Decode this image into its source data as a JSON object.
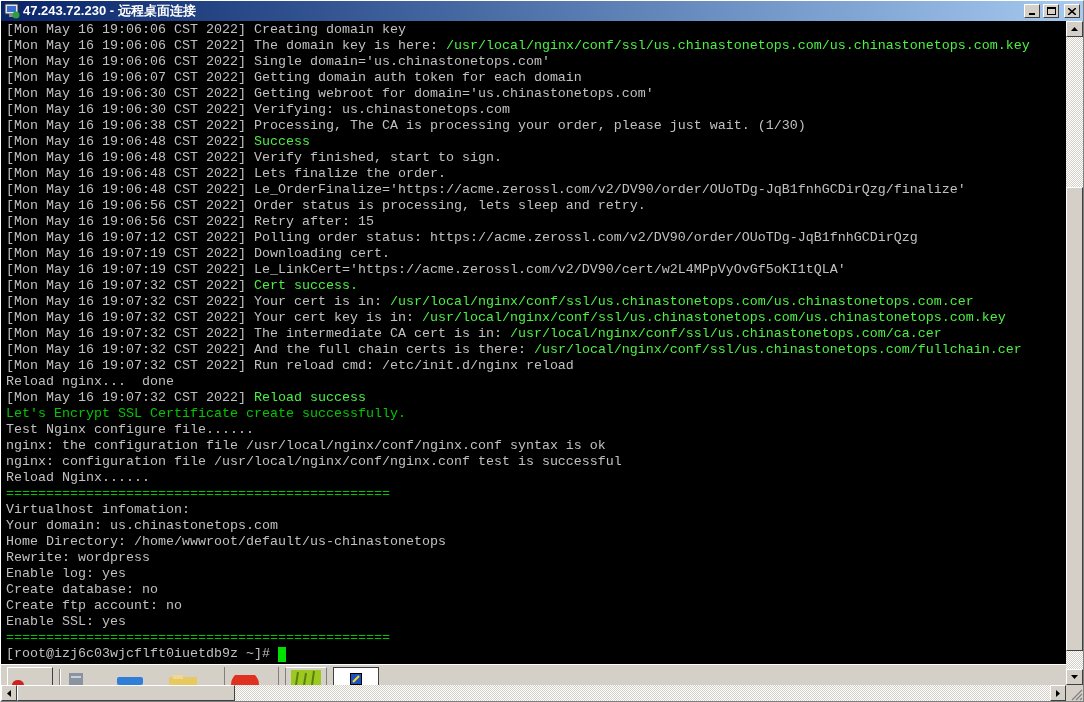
{
  "window": {
    "title": "47.243.72.230 - 远程桌面连接"
  },
  "terminal": {
    "lines": [
      {
        "parts": [
          {
            "text": "[Mon May 16 19:06:06 CST 2022] Creating domain key",
            "kind": "plain"
          }
        ]
      },
      {
        "parts": [
          {
            "text": "[Mon May 16 19:06:06 CST 2022] The domain key is here:",
            "kind": "plain"
          },
          {
            "text": "/usr/local/nginx/conf/ssl/us.chinastonetops.com/us.chinastonetops.com.key",
            "kind": "bright"
          }
        ]
      },
      {
        "parts": [
          {
            "text": "[Mon May 16 19:06:06 CST 2022] Single domain='us.chinastonetops.com'",
            "kind": "plain"
          }
        ]
      },
      {
        "parts": [
          {
            "text": "[Mon May 16 19:06:07 CST 2022] Getting domain auth token for each domain",
            "kind": "plain"
          }
        ]
      },
      {
        "parts": [
          {
            "text": "[Mon May 16 19:06:30 CST 2022] Getting webroot for domain='us.chinastonetops.com'",
            "kind": "plain"
          }
        ]
      },
      {
        "parts": [
          {
            "text": "[Mon May 16 19:06:30 CST 2022] Verifying: us.chinastonetops.com",
            "kind": "plain"
          }
        ]
      },
      {
        "parts": [
          {
            "text": "[Mon May 16 19:06:38 CST 2022] Processing, The CA is processing your order, please just wait. (1/30)",
            "kind": "plain"
          }
        ]
      },
      {
        "parts": [
          {
            "text": "[Mon May 16 19:06:48 CST 2022]",
            "kind": "plain"
          },
          {
            "text": "Success",
            "kind": "bright"
          }
        ]
      },
      {
        "parts": [
          {
            "text": "[Mon May 16 19:06:48 CST 2022] Verify finished, start to sign.",
            "kind": "plain"
          }
        ]
      },
      {
        "parts": [
          {
            "text": "[Mon May 16 19:06:48 CST 2022] Lets finalize the order.",
            "kind": "plain"
          }
        ]
      },
      {
        "parts": [
          {
            "text": "[Mon May 16 19:06:48 CST 2022] Le_OrderFinalize='https://acme.zerossl.com/v2/DV90/order/OUoTDg-JqB1fnhGCDirQzg/finalize'",
            "kind": "plain"
          }
        ]
      },
      {
        "parts": [
          {
            "text": "[Mon May 16 19:06:56 CST 2022] Order status is processing, lets sleep and retry.",
            "kind": "plain"
          }
        ]
      },
      {
        "parts": [
          {
            "text": "[Mon May 16 19:06:56 CST 2022] Retry after: 15",
            "kind": "plain"
          }
        ]
      },
      {
        "parts": [
          {
            "text": "[Mon May 16 19:07:12 CST 2022] Polling order status: https://acme.zerossl.com/v2/DV90/order/OUoTDg-JqB1fnhGCDirQzg",
            "kind": "plain"
          }
        ]
      },
      {
        "parts": [
          {
            "text": "[Mon May 16 19:07:19 CST 2022] Downloading cert.",
            "kind": "plain"
          }
        ]
      },
      {
        "parts": [
          {
            "text": "[Mon May 16 19:07:19 CST 2022] Le_LinkCert='https://acme.zerossl.com/v2/DV90/cert/w2L4MPpVyOvGf5oKI1tQLA'",
            "kind": "plain"
          }
        ]
      },
      {
        "parts": [
          {
            "text": "[Mon May 16 19:07:32 CST 2022]",
            "kind": "plain"
          },
          {
            "text": "Cert success.",
            "kind": "bright"
          }
        ]
      },
      {
        "parts": [
          {
            "text": "[Mon May 16 19:07:32 CST 2022] Your cert is in:",
            "kind": "plain"
          },
          {
            "text": "/usr/local/nginx/conf/ssl/us.chinastonetops.com/us.chinastonetops.com.cer",
            "kind": "bright"
          }
        ]
      },
      {
        "parts": [
          {
            "text": "[Mon May 16 19:07:32 CST 2022] Your cert key is in:",
            "kind": "plain"
          },
          {
            "text": "/usr/local/nginx/conf/ssl/us.chinastonetops.com/us.chinastonetops.com.key",
            "kind": "bright"
          }
        ]
      },
      {
        "parts": [
          {
            "text": "[Mon May 16 19:07:32 CST 2022] The intermediate CA cert is in:",
            "kind": "plain"
          },
          {
            "text": "/usr/local/nginx/conf/ssl/us.chinastonetops.com/ca.cer",
            "kind": "bright"
          }
        ]
      },
      {
        "parts": [
          {
            "text": "[Mon May 16 19:07:32 CST 2022] And the full chain certs is there:",
            "kind": "plain"
          },
          {
            "text": "/usr/local/nginx/conf/ssl/us.chinastonetops.com/fullchain.cer",
            "kind": "bright"
          }
        ]
      },
      {
        "parts": [
          {
            "text": "[Mon May 16 19:07:32 CST 2022] Run reload cmd: /etc/init.d/nginx reload",
            "kind": "plain"
          }
        ]
      },
      {
        "parts": [
          {
            "text": "Reload nginx...  done",
            "kind": "plain"
          }
        ]
      },
      {
        "parts": [
          {
            "text": "[Mon May 16 19:07:32 CST 2022]",
            "kind": "plain"
          },
          {
            "text": "Reload success",
            "kind": "bright"
          }
        ]
      },
      {
        "parts": [
          {
            "text": "Let's Encrypt SSL Certificate create successfully.",
            "kind": "green"
          }
        ]
      },
      {
        "parts": [
          {
            "text": "Test Nginx configure file......",
            "kind": "plain"
          }
        ]
      },
      {
        "parts": [
          {
            "text": "nginx: the configuration file /usr/local/nginx/conf/nginx.conf syntax is ok",
            "kind": "plain"
          }
        ]
      },
      {
        "parts": [
          {
            "text": "nginx: configuration file /usr/local/nginx/conf/nginx.conf test is successful",
            "kind": "plain"
          }
        ]
      },
      {
        "parts": [
          {
            "text": "Reload Nginx......",
            "kind": "plain"
          }
        ]
      },
      {
        "parts": [
          {
            "text": "================================================",
            "kind": "green"
          }
        ]
      },
      {
        "parts": [
          {
            "text": "Virtualhost infomation:",
            "kind": "plain"
          }
        ]
      },
      {
        "parts": [
          {
            "text": "Your domain: us.chinastonetops.com",
            "kind": "plain"
          }
        ]
      },
      {
        "parts": [
          {
            "text": "Home Directory: /home/wwwroot/default/us-chinastonetops",
            "kind": "plain"
          }
        ]
      },
      {
        "parts": [
          {
            "text": "Rewrite: wordpress",
            "kind": "plain"
          }
        ]
      },
      {
        "parts": [
          {
            "text": "Enable log: yes",
            "kind": "plain"
          }
        ]
      },
      {
        "parts": [
          {
            "text": "Create database: no",
            "kind": "plain"
          }
        ]
      },
      {
        "parts": [
          {
            "text": "Create ftp account: no",
            "kind": "plain"
          }
        ]
      },
      {
        "parts": [
          {
            "text": "Enable SSL: yes",
            "kind": "plain"
          }
        ]
      },
      {
        "parts": [
          {
            "text": "================================================",
            "kind": "green"
          }
        ]
      }
    ],
    "prompt": {
      "text": "[root@izj6c03wjcflft0iuetdb9z ~]#",
      "cursor": true
    }
  }
}
